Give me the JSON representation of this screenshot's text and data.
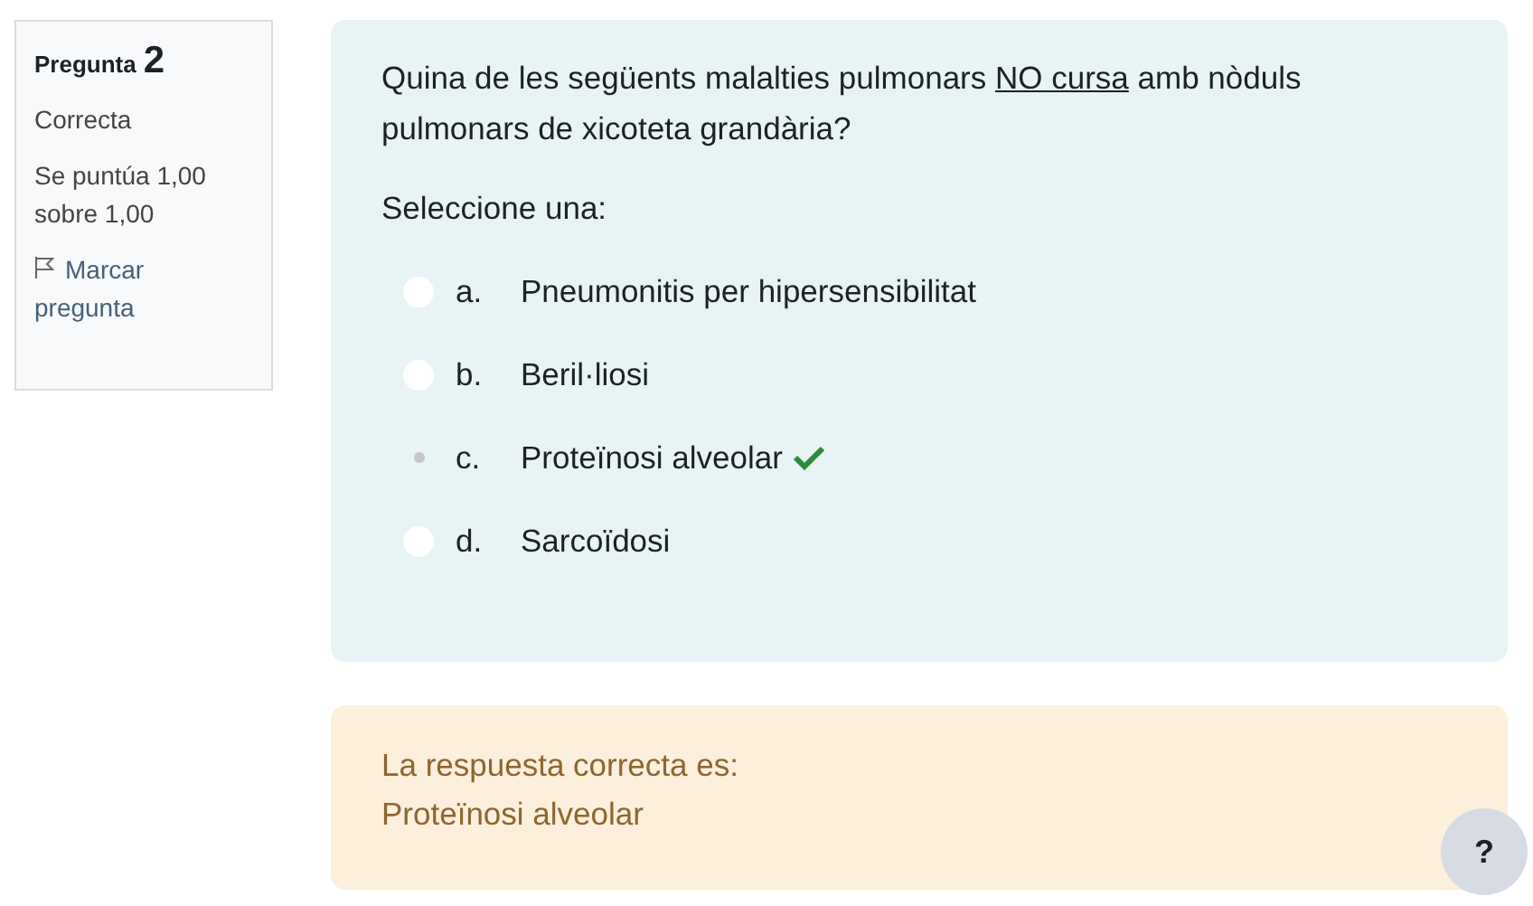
{
  "info": {
    "label": "Pregunta",
    "number": "2",
    "status": "Correcta",
    "grade": "Se puntúa 1,00 sobre 1,00",
    "flag": "Marcar pregunta"
  },
  "question": {
    "parts": [
      {
        "text": "Quina de les següents malalties pulmonars ",
        "underlined": false
      },
      {
        "text": "NO cursa",
        "underlined": true
      },
      {
        "text": " amb nòduls pulmonars de xicoteta grandària?",
        "underlined": false
      }
    ],
    "prompt": "Seleccione una:",
    "options": [
      {
        "letter": "a.",
        "text": "Pneumonitis per hipersensibilitat",
        "selected": false,
        "correct": false
      },
      {
        "letter": "b.",
        "text": "Beril·liosi",
        "selected": false,
        "correct": false
      },
      {
        "letter": "c.",
        "text": "Proteïnosi alveolar",
        "selected": true,
        "correct": true
      },
      {
        "letter": "d.",
        "text": "Sarcoïdosi",
        "selected": false,
        "correct": false
      }
    ]
  },
  "feedback": {
    "heading": "La respuesta correcta es:",
    "answer": "Proteïnosi alveolar"
  },
  "help_button": "?"
}
